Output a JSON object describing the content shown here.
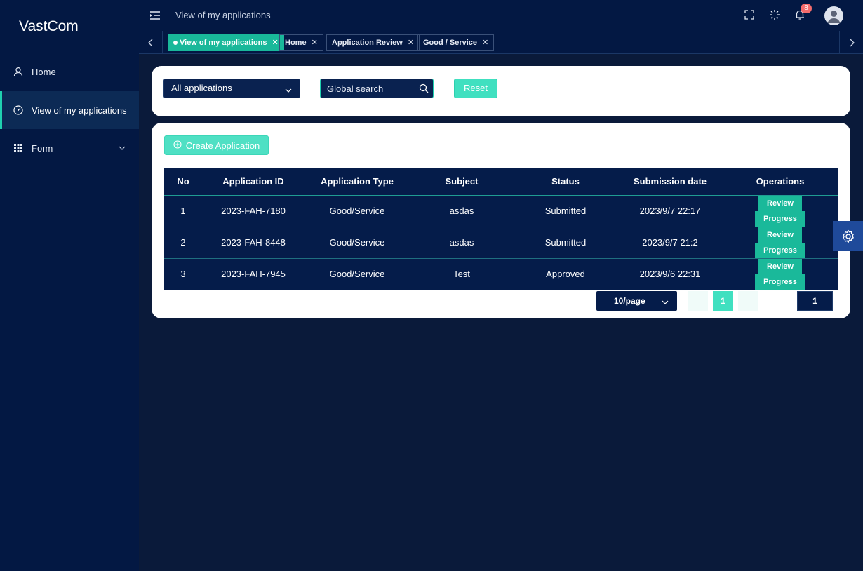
{
  "app": {
    "logo": "VastCom"
  },
  "sidebar": {
    "items": [
      {
        "label": "Home",
        "icon": "user-icon"
      },
      {
        "label": "View of my applications",
        "icon": "dashboard-icon",
        "active": true
      },
      {
        "label": "Form",
        "icon": "grid-icon",
        "expandable": true
      }
    ]
  },
  "header": {
    "title": "View of my applications",
    "notifications": "8"
  },
  "tabs": [
    {
      "label": "View of my applications",
      "active": true
    },
    {
      "label": "Home"
    },
    {
      "label": "Application Review"
    },
    {
      "label": "Good / Service"
    }
  ],
  "filters": {
    "select_value": "All applications",
    "search_placeholder": "Global search",
    "reset_label": "Reset"
  },
  "table": {
    "create_label": "Create Application",
    "columns": [
      "No",
      "Application ID",
      "Application Type",
      "Subject",
      "Status",
      "Submission date",
      "Operations"
    ],
    "rows": [
      {
        "no": "1",
        "id": "2023-FAH-7180",
        "type": "Good/Service",
        "subject": "asdas",
        "status": "Submitted",
        "date": "2023/9/7 22:17"
      },
      {
        "no": "2",
        "id": "2023-FAH-8448",
        "type": "Good/Service",
        "subject": "asdas",
        "status": "Submitted",
        "date": "2023/9/7 21:2"
      },
      {
        "no": "3",
        "id": "2023-FAH-7945",
        "type": "Good/Service",
        "subject": "Test",
        "status": "Approved",
        "date": "2023/9/6 22:31"
      }
    ],
    "review_label": "Review",
    "progress_label": "Progress"
  },
  "pagination": {
    "page_size": "10/page",
    "current_page": "1",
    "jump_value": "1"
  },
  "colors": {
    "accent": "#1ab99a",
    "sidebar_bg": "#031843",
    "content_bg": "#0a1a3a"
  }
}
